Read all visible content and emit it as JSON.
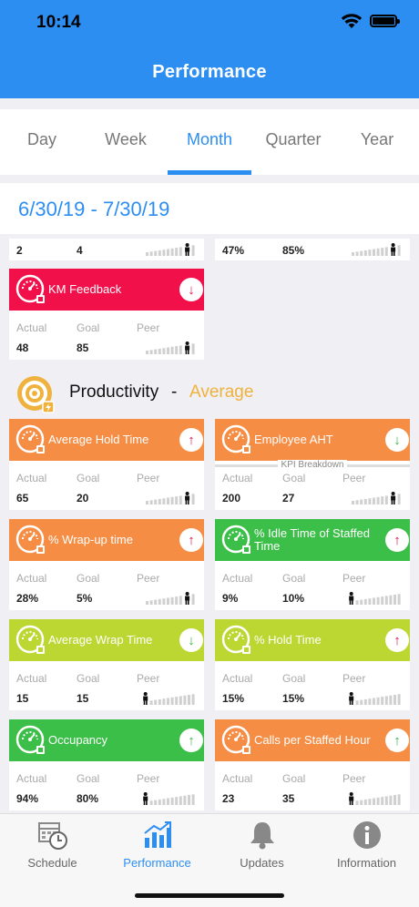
{
  "status": {
    "time": "10:14"
  },
  "header": {
    "title": "Performance"
  },
  "tabs": [
    {
      "label": "Day",
      "active": false
    },
    {
      "label": "Week",
      "active": false
    },
    {
      "label": "Month",
      "active": true
    },
    {
      "label": "Quarter",
      "active": false
    },
    {
      "label": "Year",
      "active": false
    }
  ],
  "date_range": "6/30/19 - 7/30/19",
  "top_rows": [
    {
      "actual": "2",
      "goal": "4",
      "peer_level": 0.9
    },
    {
      "actual": "47%",
      "goal": "85%",
      "peer_level": 0.9
    }
  ],
  "field_labels": {
    "actual": "Actual",
    "goal": "Goal",
    "peer": "Peer"
  },
  "km_card": {
    "title": "KM Feedback",
    "color": "#f1104a",
    "trend": "↓",
    "trend_color": "#f1104a",
    "actual": "48",
    "goal": "85",
    "peer_level": 0.9
  },
  "section": {
    "title": "Productivity",
    "dash": "-",
    "rating": "Average",
    "rating_color": "#f0b23e"
  },
  "kpi_breakdown_label": "KPI Breakdown",
  "cards": [
    {
      "title": "Average Hold Time",
      "color": "#f68d45",
      "trend": "↑",
      "trend_color": "#e2144e",
      "actual": "65",
      "goal": "20",
      "peer_level": 0.9
    },
    {
      "title": "Employee AHT",
      "color": "#f68d45",
      "trend": "↓",
      "trend_color": "#3fb54a",
      "actual": "200",
      "goal": "27",
      "peer_level": 0.9
    },
    {
      "title": "% Wrap-up time",
      "color": "#f68d45",
      "trend": "↑",
      "trend_color": "#e2144e",
      "actual": "28%",
      "goal": "5%",
      "peer_level": 0.9
    },
    {
      "title": "% Idle Time of Staffed Time",
      "color": "#3bbf48",
      "trend": "↑",
      "trend_color": "#e2144e",
      "actual": "9%",
      "goal": "10%",
      "peer_level": 0.05
    },
    {
      "title": "Average Wrap Time",
      "color": "#bcd632",
      "trend": "↓",
      "trend_color": "#3fb54a",
      "actual": "15",
      "goal": "15",
      "peer_level": 0.05
    },
    {
      "title": "% Hold Time",
      "color": "#bcd632",
      "trend": "↑",
      "trend_color": "#e2144e",
      "actual": "15%",
      "goal": "15%",
      "peer_level": 0.05
    },
    {
      "title": "Occupancy",
      "color": "#3bbf48",
      "trend": "↑",
      "trend_color": "#3fb54a",
      "actual": "94%",
      "goal": "80%",
      "peer_level": 0.05
    },
    {
      "title": "Calls per Staffed Hour",
      "color": "#f68d45",
      "trend": "↑",
      "trend_color": "#3fb54a",
      "actual": "23",
      "goal": "35",
      "peer_level": 0.05
    }
  ],
  "bottom_nav": [
    {
      "label": "Schedule",
      "icon": "calendar-clock-icon",
      "active": false
    },
    {
      "label": "Performance",
      "icon": "bar-chart-icon",
      "active": true
    },
    {
      "label": "Updates",
      "icon": "bell-icon",
      "active": false
    },
    {
      "label": "Information",
      "icon": "info-icon",
      "active": false
    }
  ]
}
